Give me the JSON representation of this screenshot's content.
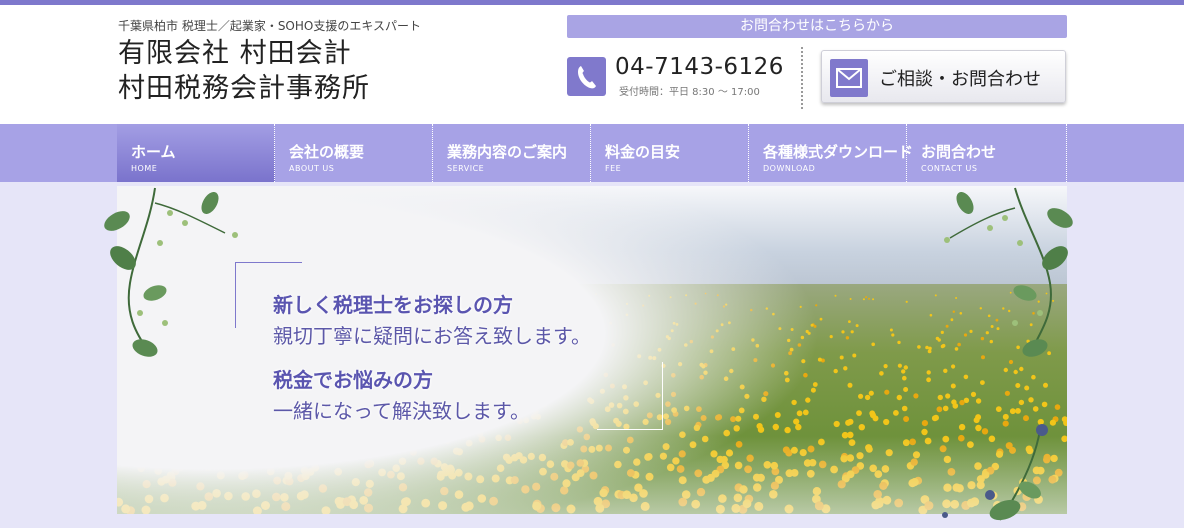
{
  "header": {
    "tagline": "千葉県柏市 税理士／起業家・SOHO支援のエキスパート",
    "company_line1": "有限会社 村田会計",
    "company_line2": "村田税務会計事務所"
  },
  "contact": {
    "banner": "お問合わせはこちらから",
    "phone_icon": "phone-icon",
    "phone": "04-7143-6126",
    "hours": "受付時間：平日 8:30 ～ 17:00",
    "mail_icon": "mail-icon",
    "button_label": "ご相談・お問合わせ"
  },
  "nav": {
    "items": [
      {
        "label": "ホーム",
        "sub": "HOME"
      },
      {
        "label": "会社の概要",
        "sub": "ABOUT US"
      },
      {
        "label": "業務内容のご案内",
        "sub": "SERVICE"
      },
      {
        "label": "料金の目安",
        "sub": "FEE"
      },
      {
        "label": "各種様式ダウンロード",
        "sub": "DOWNLOAD"
      },
      {
        "label": "お問合わせ",
        "sub": "CONTACT US"
      }
    ]
  },
  "hero": {
    "line1_head": "新しく税理士をお探しの方",
    "line1_body": "親切丁寧に疑問にお答え致します。",
    "line2_head": "税金でお悩みの方",
    "line2_body": "一緒になって解決致します。"
  },
  "colors": {
    "accent": "#7e78cc",
    "nav_bg": "#a7a2e6",
    "hero_bg": "#e6e5f8"
  }
}
